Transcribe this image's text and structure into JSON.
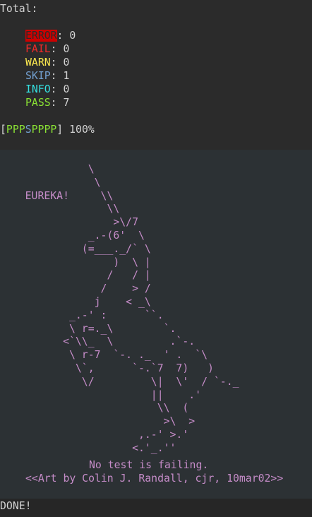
{
  "summary": {
    "title": "Total:",
    "stats": [
      {
        "label": "ERROR",
        "value": "0",
        "color": "#cc0000"
      },
      {
        "label": "FAIL",
        "value": "0",
        "color": "#ef2929"
      },
      {
        "label": "WARN",
        "value": "0",
        "color": "#fce94f"
      },
      {
        "label": "SKIP",
        "value": "1",
        "color": "#729fcf"
      },
      {
        "label": "INFO",
        "value": "0",
        "color": "#34e2e2"
      },
      {
        "label": "PASS",
        "value": "7",
        "color": "#8ae234"
      }
    ],
    "progress": {
      "open": "[",
      "marks": [
        "P",
        "P",
        "P",
        "S",
        "P",
        "P",
        "P",
        "P"
      ],
      "close": "]",
      "percent": "100%"
    }
  },
  "art": {
    "lines": [
      "              \\",
      "               \\",
      "    EUREKA!     \\\\",
      "                 \\\\",
      "                  >\\/7",
      "              _.-(6'  \\",
      "             (=___._/` \\",
      "                  )  \\ |",
      "                 /   / |",
      "                /    > /",
      "               j    < _\\",
      "           _.-' :      ``.",
      "           \\ r=._\\        `.",
      "          <`\\\\_  \\         .`-.",
      "           \\ r-7  `-. ._  ' .  `\\",
      "            \\`,      `-.`7  7)   )",
      "             \\/         \\|  \\'  / `-._",
      "                        ||    .'",
      "                         \\\\  (",
      "                          >\\  >",
      "                      ,.-' >.'",
      "                     <.'_.''"
    ],
    "message": "No test is failing.",
    "credit": "<<Art by Colin J. Randall, cjr, 10mar02>>"
  },
  "footer": {
    "status": "DONE!"
  }
}
